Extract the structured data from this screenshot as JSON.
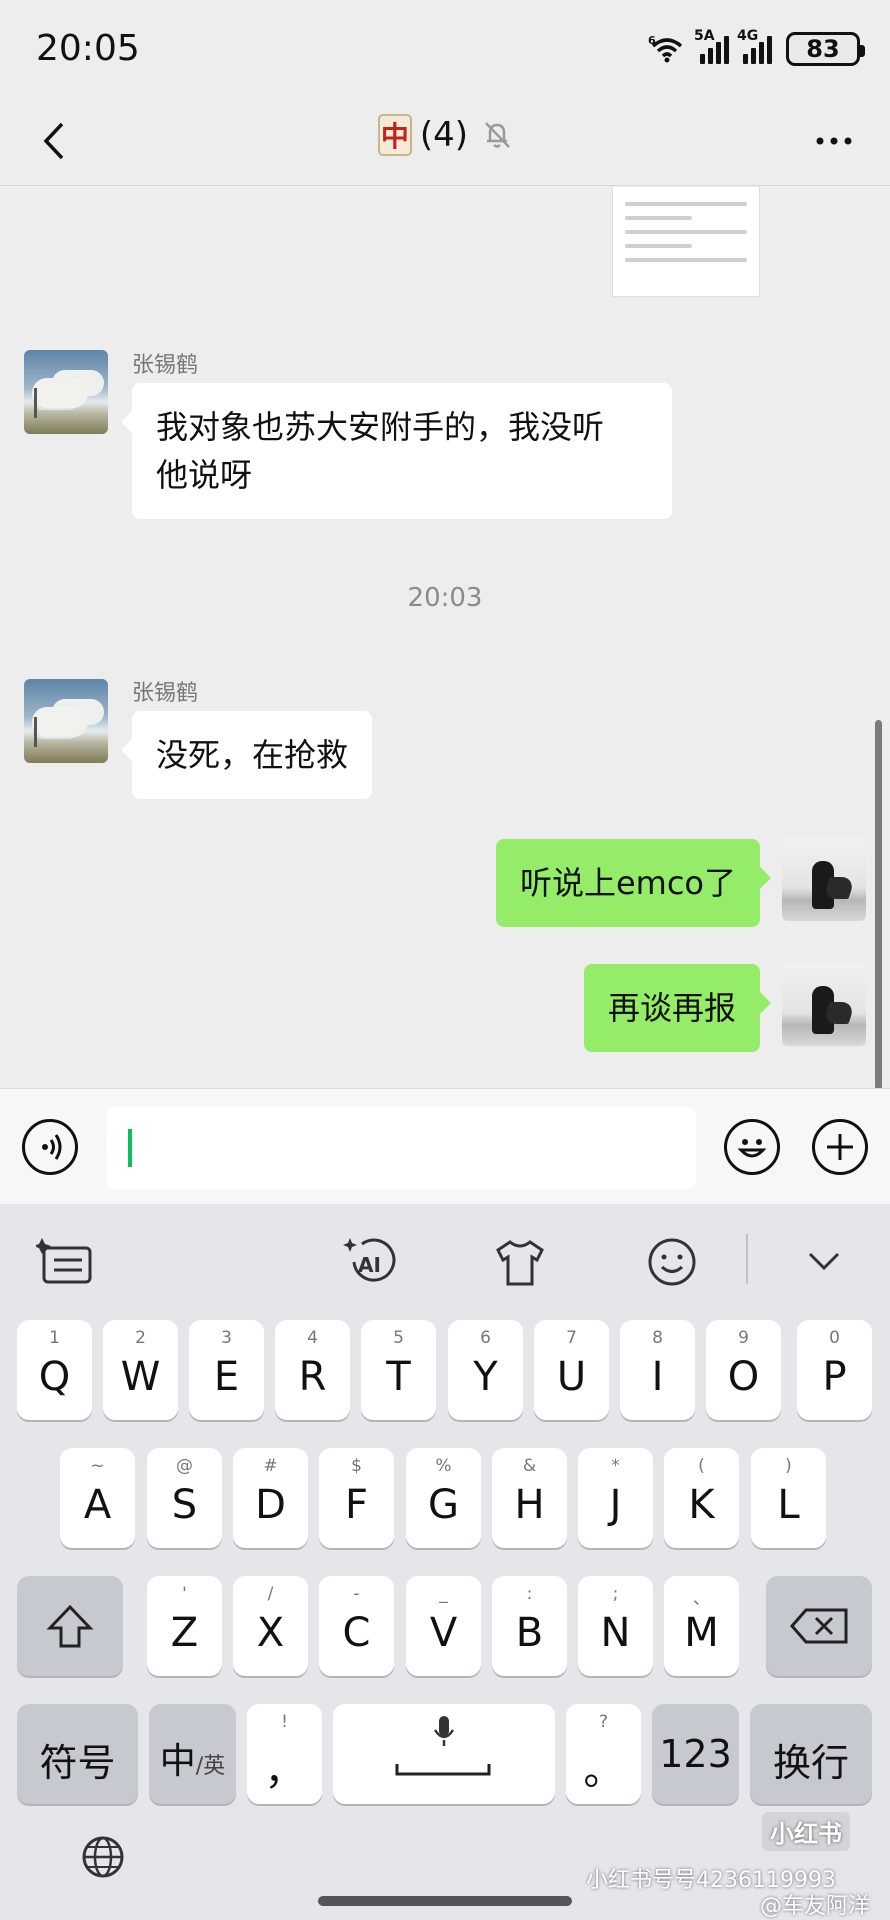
{
  "status_bar": {
    "time": "20:05",
    "wifi_label": "6",
    "signal1_label": "5A",
    "signal2_label": "4G",
    "battery": "83"
  },
  "nav": {
    "title_icon_glyph": "中",
    "title_count": "(4)"
  },
  "chat": {
    "messages": [
      {
        "sender": "张锡鹤",
        "text": "我对象也苏大安附手的，我没听他说呀",
        "line1": "我对象也苏大安附手的，我没听",
        "line2": "他说呀"
      },
      {
        "timestamp": "20:03"
      },
      {
        "sender": "张锡鹤",
        "text": "没死，在抢救"
      },
      {
        "text": "听说上emco了"
      },
      {
        "text": "再谈再报"
      }
    ]
  },
  "keyboard": {
    "row1": [
      {
        "hint": "1",
        "key": "Q"
      },
      {
        "hint": "2",
        "key": "W"
      },
      {
        "hint": "3",
        "key": "E"
      },
      {
        "hint": "4",
        "key": "R"
      },
      {
        "hint": "5",
        "key": "T"
      },
      {
        "hint": "6",
        "key": "Y"
      },
      {
        "hint": "7",
        "key": "U"
      },
      {
        "hint": "8",
        "key": "I"
      },
      {
        "hint": "9",
        "key": "O"
      },
      {
        "hint": "0",
        "key": "P"
      }
    ],
    "row2": [
      {
        "hint": "~",
        "key": "A"
      },
      {
        "hint": "@",
        "key": "S"
      },
      {
        "hint": "#",
        "key": "D"
      },
      {
        "hint": "$",
        "key": "F"
      },
      {
        "hint": "%",
        "key": "G"
      },
      {
        "hint": "&",
        "key": "H"
      },
      {
        "hint": "*",
        "key": "J"
      },
      {
        "hint": "(",
        "key": "K"
      },
      {
        "hint": ")",
        "key": "L"
      }
    ],
    "row3": [
      {
        "hint": "'",
        "key": "Z"
      },
      {
        "hint": "/",
        "key": "X"
      },
      {
        "hint": "-",
        "key": "C"
      },
      {
        "hint": "_",
        "key": "V"
      },
      {
        "hint": ":",
        "key": "B"
      },
      {
        "hint": ";",
        "key": "N"
      },
      {
        "hint": "、",
        "key": "M"
      }
    ],
    "symbols_label": "符号",
    "lang_label": "中",
    "lang_sub": "/英",
    "comma_hint": "!",
    "comma": "，",
    "period_hint": "?",
    "period": "。",
    "num_label": "123",
    "enter_label": "换行"
  },
  "watermark": {
    "badge": "小红书",
    "line1": "小红书号号4236119993",
    "line2": "@车友阿洋"
  },
  "colors": {
    "outgoing_bubble": "#95ec69",
    "incoming_bubble": "#ffffff",
    "caret": "#07c160",
    "chat_bg": "#ededed",
    "keyboard_bg": "#e4e6ea"
  }
}
